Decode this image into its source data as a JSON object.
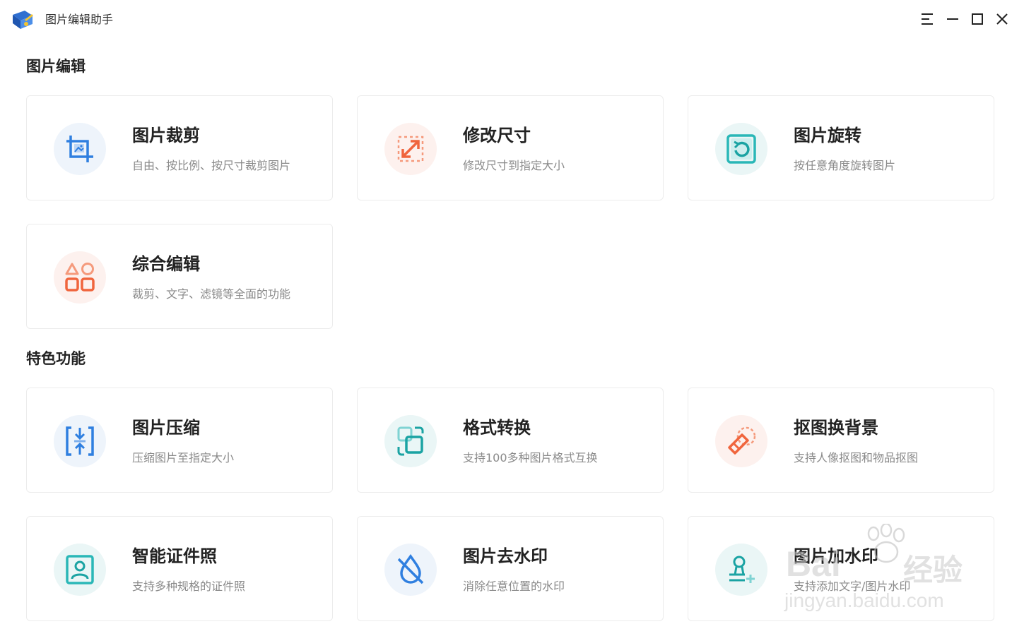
{
  "app": {
    "title": "图片编辑助手",
    "colors": {
      "accent_blue": "#2f7fe0",
      "accent_orange": "#f0653d",
      "accent_teal": "#2ab7b7"
    }
  },
  "window_controls": {
    "menu_icon": "menu-icon",
    "minimize_icon": "minimize-icon",
    "maximize_icon": "maximize-icon",
    "close_icon": "close-icon"
  },
  "sections": [
    {
      "title": "图片编辑",
      "cards": [
        {
          "title": "图片裁剪",
          "desc": "自由、按比例、按尺寸裁剪图片",
          "icon": "crop-icon"
        },
        {
          "title": "修改尺寸",
          "desc": "修改尺寸到指定大小",
          "icon": "resize-icon"
        },
        {
          "title": "图片旋转",
          "desc": "按任意角度旋转图片",
          "icon": "rotate-icon"
        },
        {
          "title": "综合编辑",
          "desc": "裁剪、文字、滤镜等全面的功能",
          "icon": "shapes-icon"
        }
      ]
    },
    {
      "title": "特色功能",
      "cards": [
        {
          "title": "图片压缩",
          "desc": "压缩图片至指定大小",
          "icon": "compress-icon"
        },
        {
          "title": "格式转换",
          "desc": "支持100多种图片格式互换",
          "icon": "convert-icon"
        },
        {
          "title": "抠图换背景",
          "desc": "支持人像抠图和物品抠图",
          "icon": "eraser-icon"
        },
        {
          "title": "智能证件照",
          "desc": "支持多种规格的证件照",
          "icon": "id-photo-icon"
        },
        {
          "title": "图片去水印",
          "desc": "消除任意位置的水印",
          "icon": "remove-watermark-icon"
        },
        {
          "title": "图片加水印",
          "desc": "支持添加文字/图片水印",
          "icon": "add-watermark-icon"
        }
      ]
    }
  ],
  "watermark": {
    "brand": "Bai",
    "name": "经验",
    "url": "jingyan.baidu.com"
  }
}
